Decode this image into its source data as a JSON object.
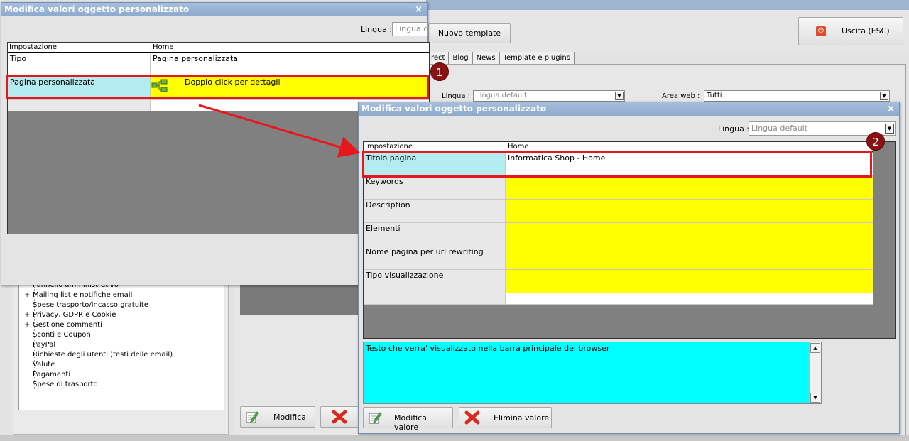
{
  "background": {
    "new_template_button": "Nuovo template",
    "exit_button": "Uscita (ESC)",
    "tabs": [
      "rect",
      "Blog",
      "News",
      "Template e plugins"
    ],
    "lingua_label": "Lingua :",
    "lingua_value": "Lingua default",
    "area_label": "Area web :",
    "area_value": "Tutti",
    "tree_items": [
      {
        "label": "Pannello amministrativo",
        "expandable": false
      },
      {
        "label": "Mailing list e notifiche email",
        "expandable": true
      },
      {
        "label": "Spese trasporto/incasso gratuite",
        "expandable": false
      },
      {
        "label": "Privacy, GDPR e Cookie",
        "expandable": true
      },
      {
        "label": "Gestione commenti",
        "expandable": true
      },
      {
        "label": "Sconti e Coupon",
        "expandable": false
      },
      {
        "label": "PayPal",
        "expandable": false
      },
      {
        "label": "Richieste degli utenti (testi delle email)",
        "expandable": false
      },
      {
        "label": "Valute",
        "expandable": false
      },
      {
        "label": "Pagamenti",
        "expandable": false
      },
      {
        "label": "Spese di trasporto",
        "expandable": false
      }
    ],
    "modifica_button": "Modifica"
  },
  "dialog1": {
    "title": "Modifica valori oggetto personalizzato",
    "close": "×",
    "lingua_label": "Lingua :",
    "lingua_value": "Lingua de",
    "col_setting": "Impostazione",
    "col_value": "Home",
    "rows": [
      {
        "setting": "Tipo",
        "value": "Pagina personalizzata"
      },
      {
        "setting": "Pagina personalizzata",
        "value": "Doppio click per dettagli"
      }
    ]
  },
  "dialog2": {
    "title": "Modifica valori oggetto personalizzato",
    "close": "×",
    "lingua_label": "Lingua :",
    "lingua_value": "Lingua default",
    "col_setting": "Impostazione",
    "col_value": "Home",
    "rows": [
      {
        "setting": "Titolo pagina",
        "value": "Informatica Shop - Home"
      },
      {
        "setting": "Keywords",
        "value": ""
      },
      {
        "setting": "Description",
        "value": ""
      },
      {
        "setting": "Elementi",
        "value": ""
      },
      {
        "setting": "Nome pagina per url rewriting",
        "value": ""
      },
      {
        "setting": "Tipo visualizzazione",
        "value": ""
      }
    ],
    "description_text": "Testo che verra' visualizzato nella barra principale del browser",
    "modifica_valore": "Modifica valore",
    "elimina_valore": "Elimina valore"
  },
  "annotations": {
    "badge1": "1",
    "badge2": "2"
  },
  "colors": {
    "selected_row": "#b3ecf0",
    "value_cell": "#ffff00",
    "description_bg": "#00ffff",
    "highlight": "#e8171d",
    "badge": "#8b1212"
  }
}
